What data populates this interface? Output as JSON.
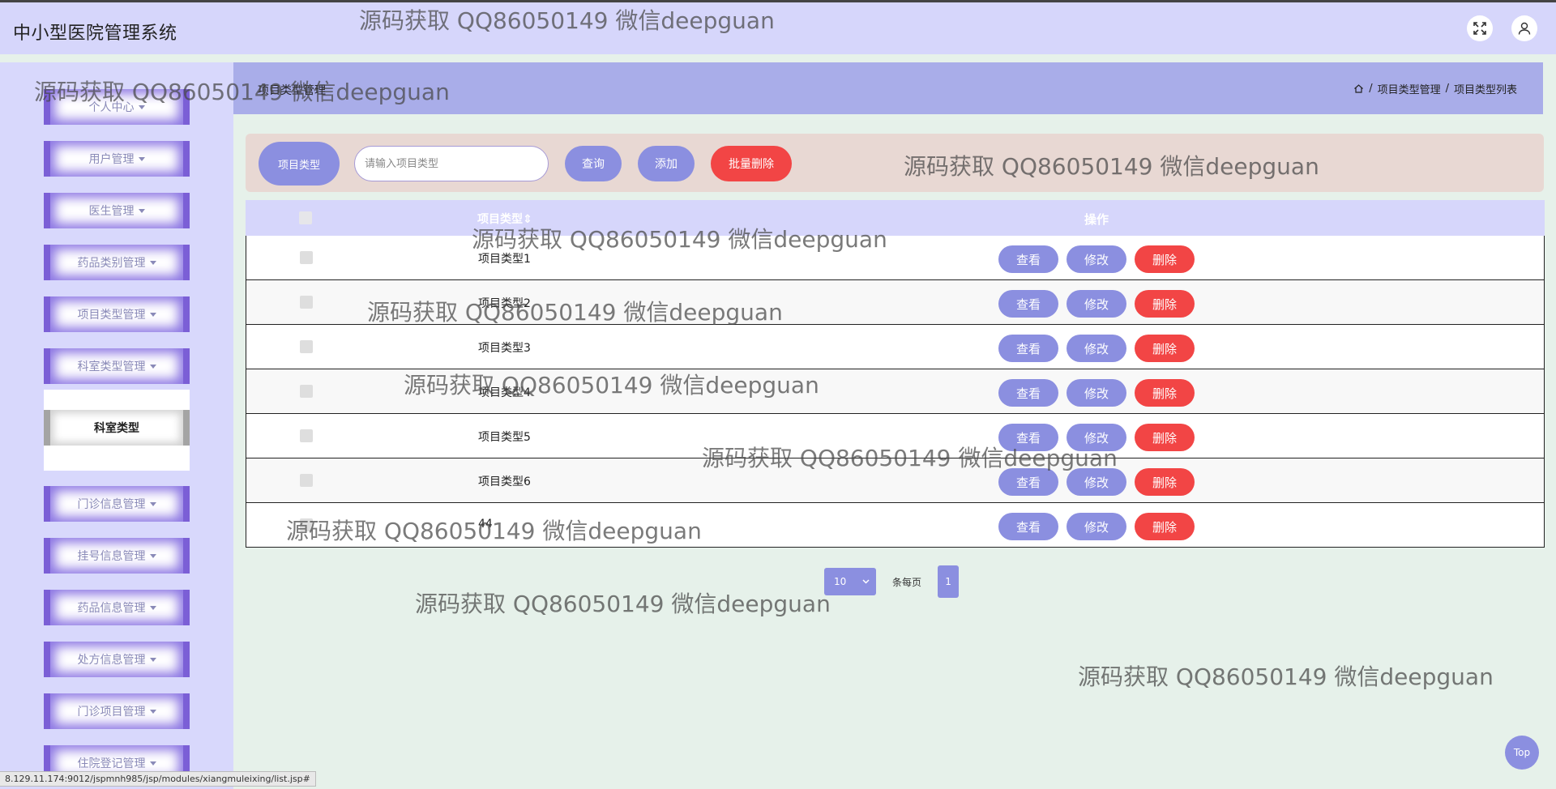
{
  "app": {
    "title": "中小型医院管理系统"
  },
  "header_icons": {
    "fullscreen": "fullscreen-icon",
    "user": "user-icon"
  },
  "sidebar": {
    "items": [
      {
        "label": "个人中心"
      },
      {
        "label": "用户管理"
      },
      {
        "label": "医生管理"
      },
      {
        "label": "药品类别管理"
      },
      {
        "label": "项目类型管理"
      },
      {
        "label": "科室类型管理"
      },
      {
        "label": "门诊信息管理"
      },
      {
        "label": "挂号信息管理"
      },
      {
        "label": "药品信息管理"
      },
      {
        "label": "处方信息管理"
      },
      {
        "label": "门诊项目管理"
      },
      {
        "label": "住院登记管理"
      }
    ],
    "submenu": {
      "label": "科室类型"
    }
  },
  "page": {
    "title": "项目类型管理",
    "breadcrumb": [
      "项目类型管理",
      "项目类型列表"
    ],
    "breadcrumb_separator": "/"
  },
  "search": {
    "label": "项目类型",
    "placeholder": "请输入项目类型",
    "query_button": "查询",
    "add_button": "添加",
    "batch_delete_button": "批量删除"
  },
  "table": {
    "columns": {
      "name": "项目类型",
      "ops": "操作"
    },
    "rows": [
      {
        "name": "项目类型1"
      },
      {
        "name": "项目类型2"
      },
      {
        "name": "项目类型3"
      },
      {
        "name": "项目类型4"
      },
      {
        "name": "项目类型5"
      },
      {
        "name": "项目类型6"
      },
      {
        "name": "44"
      }
    ],
    "actions": {
      "view": "查看",
      "edit": "修改",
      "delete": "删除"
    }
  },
  "pagination": {
    "page_size": "10",
    "per_page_label": "条每页",
    "current_page": "1"
  },
  "back_to_top": "Top",
  "status_url": "8.129.11.174:9012/jspmnh985/jsp/modules/xiangmuleixing/list.jsp#",
  "watermark": "源码获取 QQ86050149 微信deepguan",
  "colors": {
    "primary": "#8b8fe0",
    "danger": "#f24545",
    "topbar": "#d6d6fb",
    "sidebar": "#d8d8fc",
    "accent_border": "#7b5fd6",
    "page_bg": "#e6f1ea"
  }
}
